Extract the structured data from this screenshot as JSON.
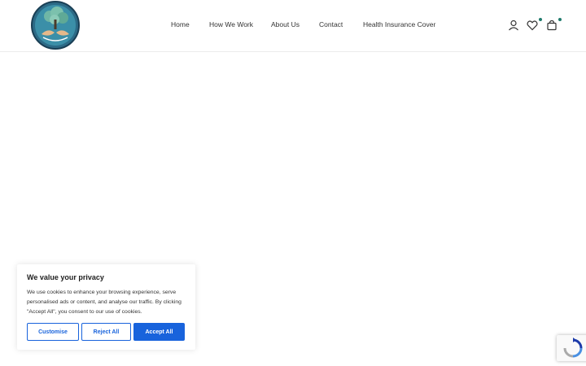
{
  "header": {
    "logo_icon": "tree-hands-logo-icon",
    "nav": [
      {
        "label": "Home"
      },
      {
        "label": "How We Work"
      },
      {
        "label": "About Us"
      },
      {
        "label": "Contact"
      },
      {
        "label": "Health Insurance Cover"
      }
    ],
    "icons": {
      "account": "user-icon",
      "wishlist": "heart-icon",
      "cart": "bag-icon",
      "wishlist_count": "0",
      "cart_count": "0"
    }
  },
  "cookie_banner": {
    "title": "We value your privacy",
    "text": "We use cookies to enhance your browsing experience, serve personalised ads or content, and analyse our traffic. By clicking \"Accept All\", you consent to our use of cookies.",
    "customise_label": "Customise",
    "reject_label": "Reject All",
    "accept_label": "Accept All"
  },
  "recaptcha": {
    "icon": "recaptcha-icon"
  },
  "colors": {
    "accent": "#1863dc",
    "brand_teal": "#1f7a6b"
  }
}
